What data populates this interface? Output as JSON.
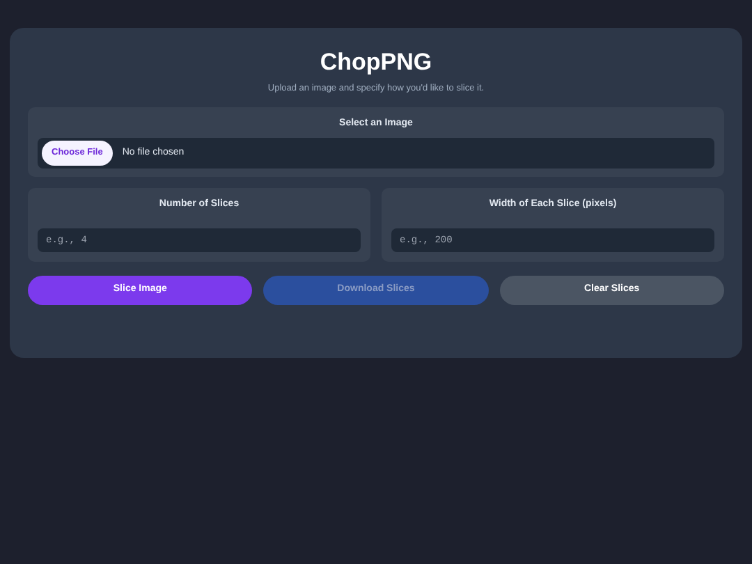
{
  "app": {
    "title": "ChopPNG",
    "subtitle": "Upload an image and specify how you'd like to slice it."
  },
  "file_section": {
    "label": "Select an Image",
    "button": "Choose File",
    "status": "No file chosen"
  },
  "fields": [
    {
      "label": "Number of Slices",
      "placeholder": "e.g., 4"
    },
    {
      "label": "Width of Each Slice (pixels)",
      "placeholder": "e.g., 200"
    }
  ],
  "buttons": [
    {
      "label": "Slice Image",
      "kind": "primary",
      "disabled": false
    },
    {
      "label": "Download Slices",
      "kind": "download",
      "disabled": true
    },
    {
      "label": "Clear Slices",
      "kind": "secondary",
      "disabled": false
    }
  ]
}
